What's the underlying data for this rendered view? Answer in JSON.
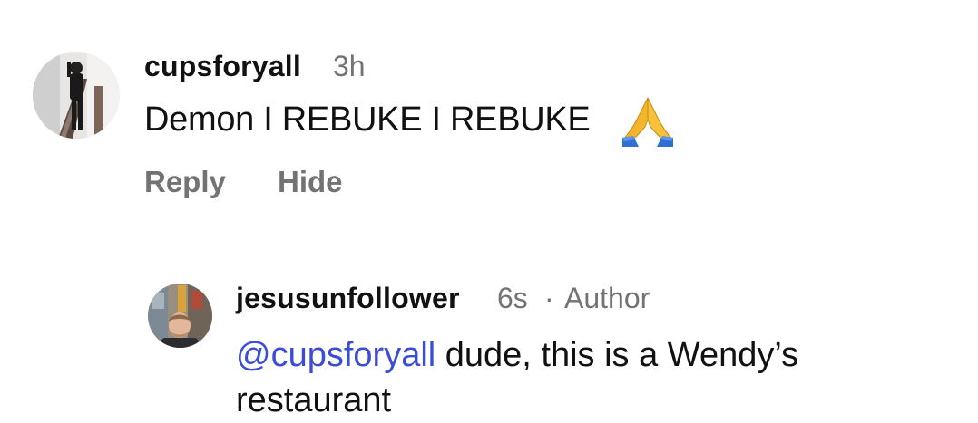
{
  "comment": {
    "username": "cupsforyall",
    "time": "3h",
    "text": "Demon I REBUKE I REBUKE",
    "emoji": "praying-hands",
    "actions": {
      "reply": "Reply",
      "hide": "Hide"
    }
  },
  "reply": {
    "username": "jesusunfollower",
    "time": "6s",
    "separator": "·",
    "badge": "Author",
    "mention": "@cupsforyall",
    "text": " dude, this is a Wendy’s restaurant"
  },
  "colors": {
    "text": "#111111",
    "muted": "#737373",
    "mention": "#3b4dd8"
  }
}
